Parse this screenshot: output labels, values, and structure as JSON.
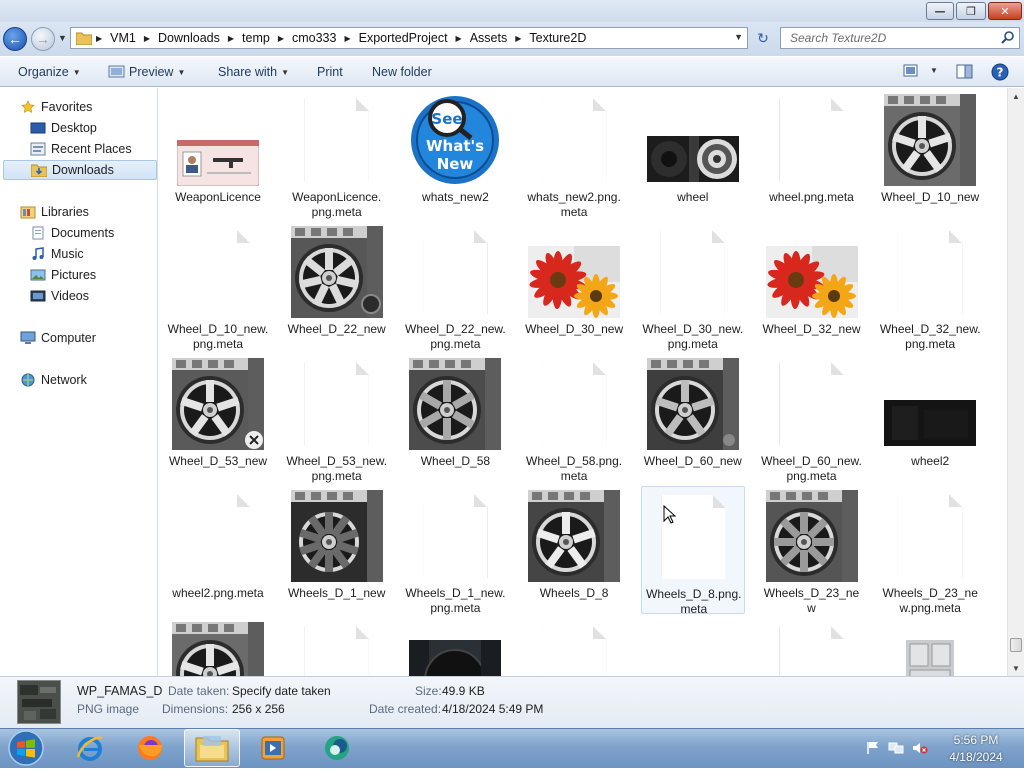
{
  "window": {
    "min_glyph": "—",
    "max_glyph": "❐",
    "close_glyph": "✕"
  },
  "address": {
    "crumbs": [
      "VM1",
      "Downloads",
      "temp",
      "cmo333",
      "ExportedProject",
      "Assets",
      "Texture2D"
    ],
    "search_placeholder": "Search Texture2D"
  },
  "toolbar": {
    "organize": "Organize",
    "preview": "Preview",
    "share_with": "Share with",
    "print": "Print",
    "new_folder": "New folder"
  },
  "sidebar": {
    "favorites": "Favorites",
    "desktop": "Desktop",
    "recent_places": "Recent Places",
    "downloads": "Downloads",
    "libraries": "Libraries",
    "documents": "Documents",
    "music": "Music",
    "pictures": "Pictures",
    "videos": "Videos",
    "computer": "Computer",
    "network": "Network"
  },
  "files": [
    {
      "name": "WeaponLicence",
      "kind": "licence"
    },
    {
      "name": "WeaponLicence.\npng.meta",
      "kind": "doc"
    },
    {
      "name": "whats_new2",
      "kind": "whatsnew"
    },
    {
      "name": "whats_new2.png.\nmeta",
      "kind": "doc"
    },
    {
      "name": "wheel",
      "kind": "wheelstrip"
    },
    {
      "name": "wheel.png.meta",
      "kind": "doc"
    },
    {
      "name": "Wheel_D_10_new",
      "kind": "wheelA"
    },
    {
      "name": "Wheel_D_10_new.\npng.meta",
      "kind": "doc"
    },
    {
      "name": "Wheel_D_22_new",
      "kind": "wheelB"
    },
    {
      "name": "Wheel_D_22_new.\npng.meta",
      "kind": "doc"
    },
    {
      "name": "Wheel_D_30_new",
      "kind": "flowers"
    },
    {
      "name": "Wheel_D_30_new.\npng.meta",
      "kind": "doc"
    },
    {
      "name": "Wheel_D_32_new",
      "kind": "flowers"
    },
    {
      "name": "Wheel_D_32_new.\npng.meta",
      "kind": "doc"
    },
    {
      "name": "Wheel_D_53_new",
      "kind": "wheelC"
    },
    {
      "name": "Wheel_D_53_new.\npng.meta",
      "kind": "doc"
    },
    {
      "name": "Wheel_D_58",
      "kind": "wheelD"
    },
    {
      "name": "Wheel_D_58.png.\nmeta",
      "kind": "doc"
    },
    {
      "name": "Wheel_D_60_new",
      "kind": "wheelE"
    },
    {
      "name": "Wheel_D_60_new.\npng.meta",
      "kind": "doc"
    },
    {
      "name": "wheel2",
      "kind": "dark"
    },
    {
      "name": "wheel2.png.meta",
      "kind": "doc"
    },
    {
      "name": "Wheels_D_1_new",
      "kind": "wheelF"
    },
    {
      "name": "Wheels_D_1_new.\npng.meta",
      "kind": "doc"
    },
    {
      "name": "Wheels_D_8",
      "kind": "wheelG"
    },
    {
      "name": "Wheels_D_8.png.\nmeta",
      "kind": "doc",
      "selected": true
    },
    {
      "name": "Wheels_D_23_ne\nw",
      "kind": "wheelH"
    },
    {
      "name": "Wheels_D_23_ne\nw.png.meta",
      "kind": "doc"
    },
    {
      "name": "",
      "kind": "wheelA"
    },
    {
      "name": "",
      "kind": "doc"
    },
    {
      "name": "",
      "kind": "tire"
    },
    {
      "name": "",
      "kind": "doc"
    },
    {
      "name": "",
      "kind": "blank"
    },
    {
      "name": "",
      "kind": "doc"
    },
    {
      "name": "",
      "kind": "metal"
    }
  ],
  "details": {
    "file_name": "WP_FAMAS_D",
    "file_type": "PNG image",
    "date_taken_label": "Date taken:",
    "date_taken_value": "Specify date taken",
    "dimensions_label": "Dimensions:",
    "dimensions_value": "256 x 256",
    "size_label": "Size:",
    "size_value": "49.9 KB",
    "date_created_label": "Date created:",
    "date_created_value": "4/18/2024 5:49 PM"
  },
  "clock": {
    "time": "5:56 PM",
    "date": "4/18/2024"
  }
}
